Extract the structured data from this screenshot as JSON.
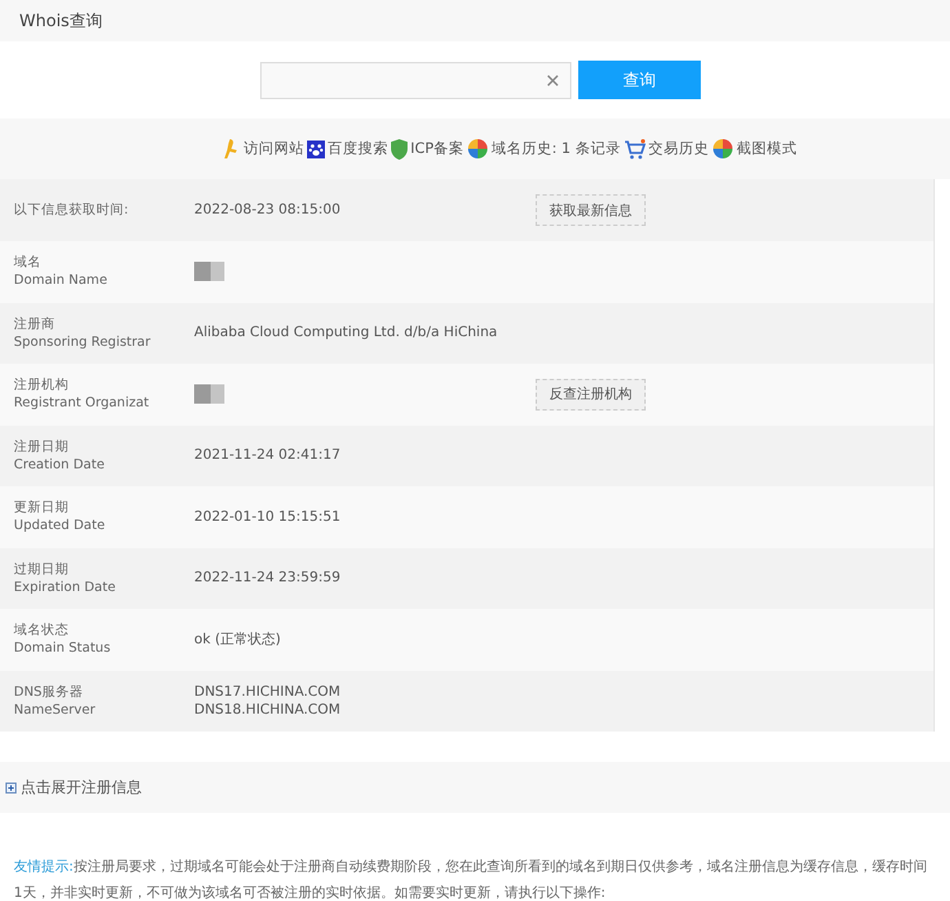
{
  "header": {
    "title": "Whois查询"
  },
  "search": {
    "button": "查询"
  },
  "links": [
    {
      "kind": "walker",
      "label": "访问网站"
    },
    {
      "kind": "paw",
      "label": "百度搜索"
    },
    {
      "kind": "shield",
      "label": "ICP备案"
    },
    {
      "kind": "pie",
      "label": "域名历史: 1 条记录"
    },
    {
      "kind": "cart",
      "label": "交易历史"
    },
    {
      "kind": "pie",
      "label": "截图模式"
    }
  ],
  "rows": [
    {
      "kind": "single",
      "label": "以下信息获取时间:",
      "values": [
        "2022-08-23 08:15:00"
      ],
      "button": "获取最新信息"
    },
    {
      "kind": "double",
      "label": "域名",
      "label_en": "Domain Name",
      "values": [],
      "redacted": true
    },
    {
      "kind": "double",
      "label": "注册商",
      "label_en": "Sponsoring Registrar",
      "values": [
        "Alibaba Cloud Computing Ltd. d/b/a HiChina"
      ]
    },
    {
      "kind": "double",
      "label": "注册机构",
      "label_en": "Registrant Organizat",
      "values": [],
      "button": "反查注册机构",
      "redacted": true
    },
    {
      "kind": "double",
      "label": "注册日期",
      "label_en": "Creation Date",
      "values": [
        "2021-11-24 02:41:17"
      ]
    },
    {
      "kind": "double",
      "label": "更新日期",
      "label_en": "Updated Date",
      "values": [
        "2022-01-10 15:15:51"
      ]
    },
    {
      "kind": "double",
      "label": "过期日期",
      "label_en": "Expiration Date",
      "values": [
        "2022-11-24 23:59:59"
      ]
    },
    {
      "kind": "double",
      "label": "域名状态",
      "label_en": "Domain Status",
      "values": [
        "ok (正常状态)"
      ]
    },
    {
      "kind": "double",
      "label": "DNS服务器",
      "label_en": "NameServer",
      "values": [
        "DNS17.HICHINA.COM",
        "DNS18.HICHINA.COM"
      ]
    }
  ],
  "expand": {
    "label": "点击展开注册信息",
    "expanded": false
  },
  "notice": {
    "lead": "友情提示:",
    "text": "按注册局要求，过期域名可能会处于注册商自动续费期阶段，您在此查询所看到的域名到期日仅供参考，域名注册信息为缓存信息，缓存时间1天，并非实时更新，不可做为该域名可否被注册的实时依据。如需要实时更新，请执行以下操作:"
  }
}
